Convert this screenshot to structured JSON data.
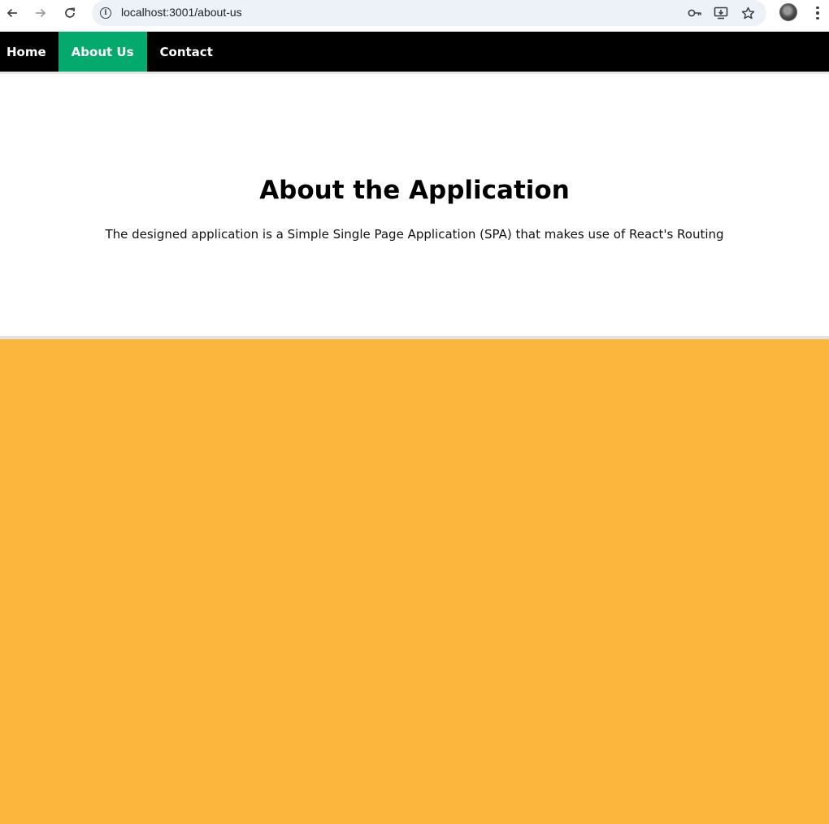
{
  "browser": {
    "url": "localhost:3001/about-us",
    "icons": {
      "back": "arrow-left-icon",
      "forward": "arrow-right-icon",
      "reload": "reload-icon",
      "info": "info-icon",
      "key": "key-icon",
      "install": "install-app-icon",
      "star": "star-icon",
      "menu": "more-vert-icon"
    }
  },
  "nav": {
    "items": [
      {
        "label": "Home",
        "active": false
      },
      {
        "label": "About Us",
        "active": true
      },
      {
        "label": "Contact",
        "active": false
      }
    ],
    "background": "#000000",
    "active_color": "#04aa6d"
  },
  "content": {
    "title": "About the Application",
    "description": "The designed application is a Simple Single Page Application (SPA) that makes use of React's Routing"
  },
  "footer": {
    "background": "#fcb53d"
  }
}
